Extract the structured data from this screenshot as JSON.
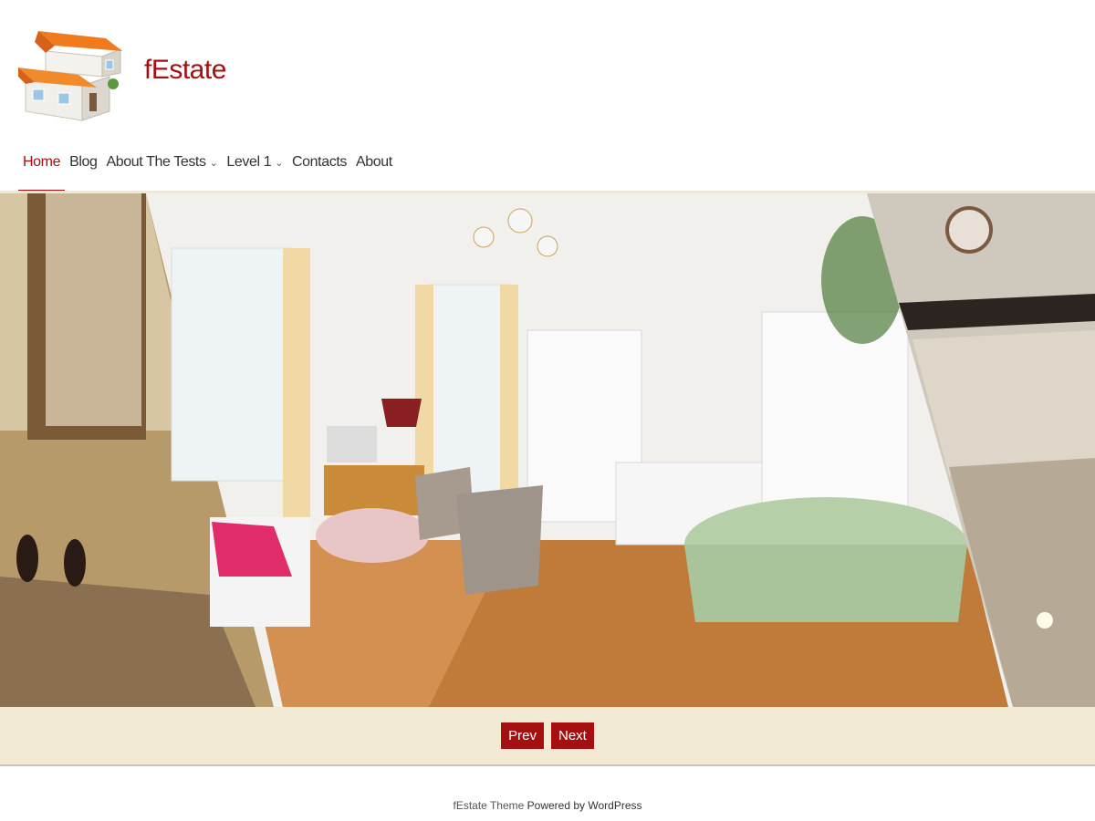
{
  "site": {
    "title": "fEstate",
    "logo_icon": "house-icon"
  },
  "nav": {
    "items": [
      {
        "label": "Home",
        "active": true,
        "has_dropdown": false
      },
      {
        "label": "Blog",
        "active": false,
        "has_dropdown": false
      },
      {
        "label": "About The Tests",
        "active": false,
        "has_dropdown": true
      },
      {
        "label": "Level 1",
        "active": false,
        "has_dropdown": true
      },
      {
        "label": "Contacts",
        "active": false,
        "has_dropdown": false
      },
      {
        "label": "About",
        "active": false,
        "has_dropdown": false
      }
    ]
  },
  "slider": {
    "prev_label": "Prev",
    "next_label": "Next"
  },
  "footer": {
    "theme_text": "fEstate Theme",
    "powered_text": "Powered by WordPress"
  },
  "colors": {
    "accent": "#a50f0f",
    "controls_bg": "#f3ead3"
  }
}
